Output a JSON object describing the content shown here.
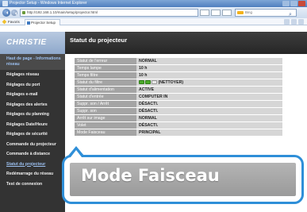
{
  "browser": {
    "window_title": "Projector Setup - Windows Internet Explorer",
    "url": "http://192.168.1.10/main/setup/projector.html",
    "search_placeholder": "Bing",
    "favorites_label": "Favoris",
    "tab_label": "Projector Setup"
  },
  "sidebar": {
    "logo": "CHRISTIE",
    "items": [
      {
        "label": "Haut de page - Informations réseau"
      },
      {
        "label": "Réglages réseau"
      },
      {
        "label": "Réglages du port"
      },
      {
        "label": "Réglages e-mail"
      },
      {
        "label": "Réglages des alertes"
      },
      {
        "label": "Réglages du planning"
      },
      {
        "label": "Réglages Date/Heure"
      },
      {
        "label": "Réglages de sécurité"
      },
      {
        "label": "Commande du projecteur"
      },
      {
        "label": "Commande à distance"
      },
      {
        "label": "Statut du projecteur"
      },
      {
        "label": "Redémarrage du réseau"
      },
      {
        "label": "Test de connexion"
      }
    ]
  },
  "main": {
    "title": "Statut du projecteur",
    "rows": [
      {
        "label": "Statut de l'erreur",
        "value": "NORMAL"
      },
      {
        "label": "Temps lampe",
        "value": "10 h"
      },
      {
        "label": "Temps filtre",
        "value": "10 h"
      },
      {
        "label": "Statut du filtre",
        "value": "(NETTOYER)"
      },
      {
        "label": "Statut d'alimentation",
        "value": "ACTIVE"
      },
      {
        "label": "Statut d'entrée",
        "value": "COMPUTER IN"
      },
      {
        "label": "Suppr. son / Arrêt",
        "value": "DÉSACTI."
      },
      {
        "label": "Suppr. son",
        "value": "DÉSACTI."
      },
      {
        "label": "Arrêt sur image",
        "value": "NORMAL"
      },
      {
        "label": "Volet",
        "value": "DÉSACTI."
      },
      {
        "label": "Mode Faisceau",
        "value": "PRINCIPAL"
      }
    ]
  },
  "callout": {
    "text": "Mode Faisceau",
    "color": "#2f8fd8"
  },
  "colors": {
    "sidebar_bg": "#333333",
    "header_bg": "#2e2e2e",
    "label_bg": "#a4a4a4",
    "value_bg": "#d6d6d6",
    "filter_green": "#4caa2a"
  }
}
